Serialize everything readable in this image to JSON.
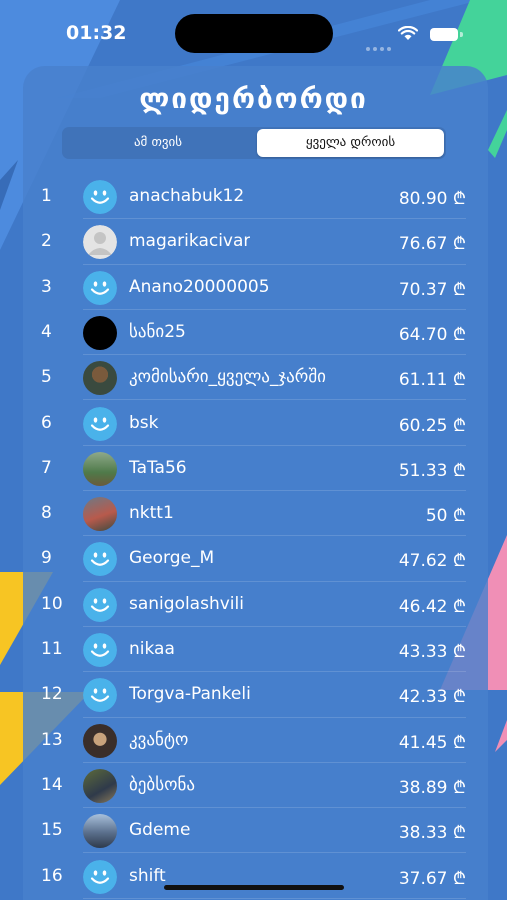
{
  "status_bar": {
    "time": "01:32"
  },
  "header": {
    "title": "ლიდერბორდი"
  },
  "tabs": {
    "month": "ამ თვის",
    "all_time": "ყველა დროის",
    "selected": "all_time"
  },
  "leaderboard": [
    {
      "rank": "1",
      "username": "anachabuk12",
      "score": "80.90 ₾",
      "avatar": "smiley-icon"
    },
    {
      "rank": "2",
      "username": "magarikacivar",
      "score": "76.67 ₾",
      "avatar": "default-person-avatar"
    },
    {
      "rank": "3",
      "username": "Anano20000005",
      "score": "70.37 ₾",
      "avatar": "smiley-icon"
    },
    {
      "rank": "4",
      "username": "სანი25",
      "score": "64.70 ₾",
      "avatar": "black-circle-avatar"
    },
    {
      "rank": "5",
      "username": "კომისარი_ყველა_ჯარში",
      "score": "61.11 ₾",
      "avatar": "photo-avatar"
    },
    {
      "rank": "6",
      "username": "bsk",
      "score": "60.25 ₾",
      "avatar": "smiley-icon"
    },
    {
      "rank": "7",
      "username": "TaTa56",
      "score": "51.33 ₾",
      "avatar": "photo-avatar"
    },
    {
      "rank": "8",
      "username": "nktt1",
      "score": "50 ₾",
      "avatar": "photo-avatar"
    },
    {
      "rank": "9",
      "username": "George_M",
      "score": "47.62 ₾",
      "avatar": "smiley-icon"
    },
    {
      "rank": "10",
      "username": "sanigolashvili",
      "score": "46.42 ₾",
      "avatar": "smiley-icon"
    },
    {
      "rank": "11",
      "username": "nikaa",
      "score": "43.33 ₾",
      "avatar": "smiley-icon"
    },
    {
      "rank": "12",
      "username": "Torgva-Pankeli",
      "score": "42.33 ₾",
      "avatar": "smiley-icon"
    },
    {
      "rank": "13",
      "username": "კვანტო",
      "score": "41.45 ₾",
      "avatar": "photo-avatar"
    },
    {
      "rank": "14",
      "username": "ბებსონა",
      "score": "38.89 ₾",
      "avatar": "photo-avatar"
    },
    {
      "rank": "15",
      "username": "Gdeme",
      "score": "38.33 ₾",
      "avatar": "photo-avatar"
    },
    {
      "rank": "16",
      "username": "shift",
      "score": "37.67 ₾",
      "avatar": "smiley-icon"
    }
  ],
  "colors": {
    "background": "#3f78c8",
    "smiley": "#4ab2ea",
    "accent_green": "#44d39a",
    "accent_yellow": "#f7c523",
    "accent_pink": "#f08fb6"
  }
}
